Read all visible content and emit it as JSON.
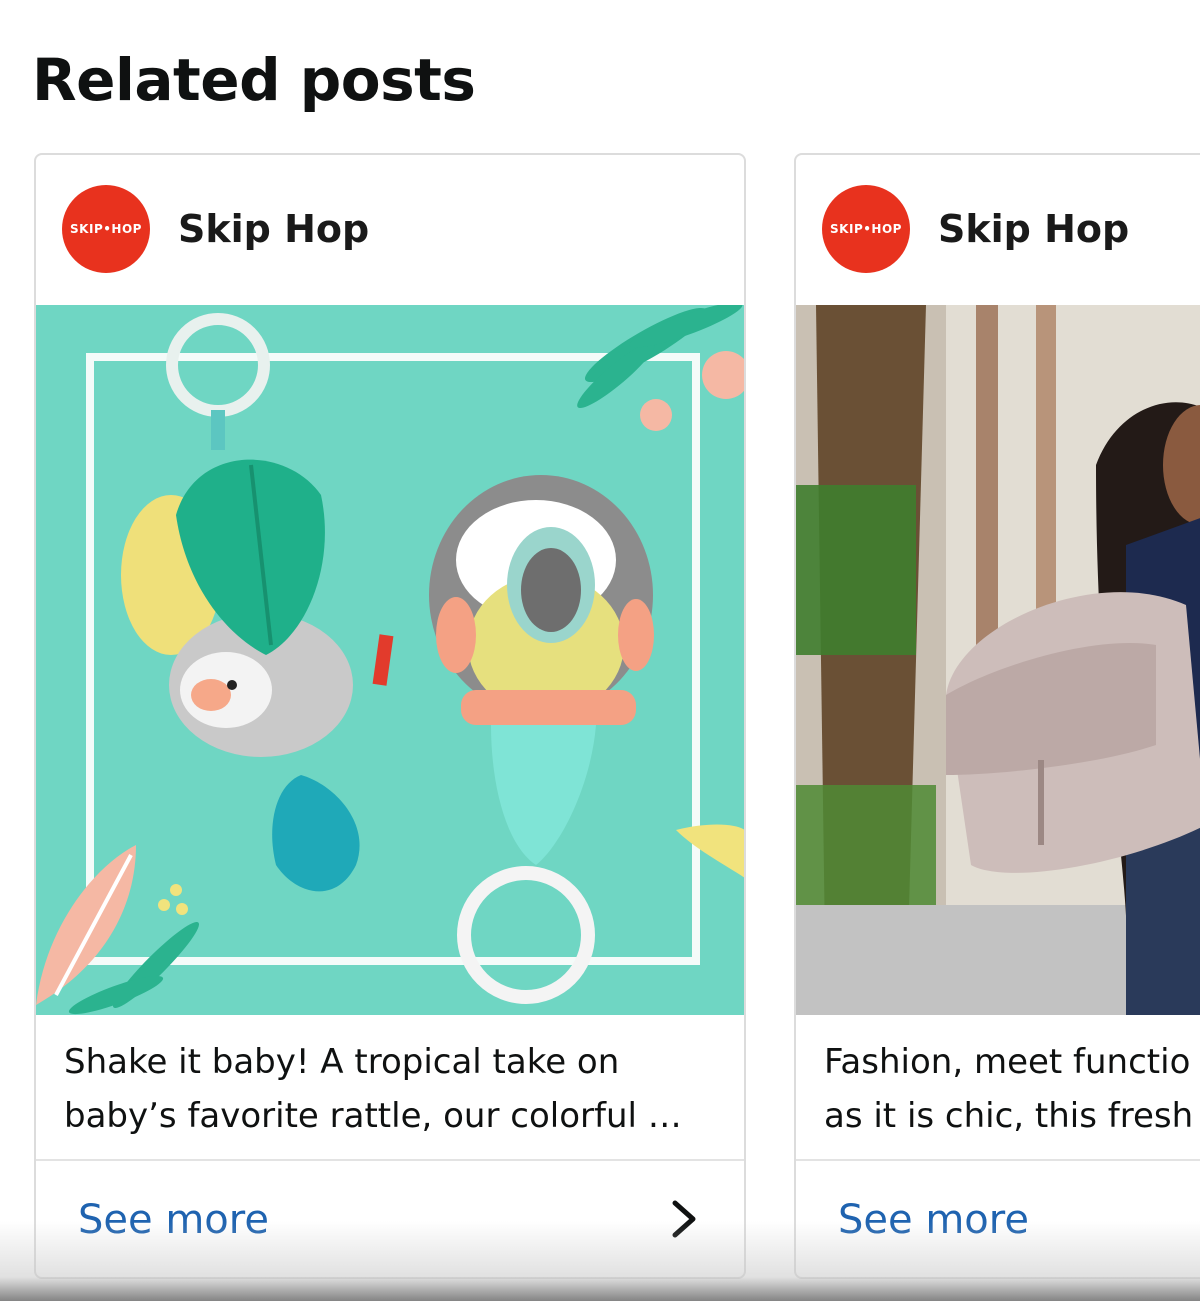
{
  "section": {
    "title": "Related posts"
  },
  "posts": [
    {
      "brand": "Skip Hop",
      "logo_text": "SKIP•HOP",
      "image_alt": "Skip Hop tropical sloth and toucan rattle toys on a mint background",
      "caption_lines": [
        "Shake it baby! A tropical take on",
        "baby’s favorite rattle, our colorful …"
      ],
      "see_more": "See more",
      "chevron_icon": "chevron-right-icon"
    },
    {
      "brand": "Skip Hop",
      "logo_text": "SKIP•HOP",
      "image_alt": "Woman carrying a taupe Skip Hop diaper backpack on a sidewalk",
      "caption_lines": [
        "Fashion, meet functio",
        "as it is chic, this fresh"
      ],
      "see_more": "See more"
    }
  ],
  "colors": {
    "logo_red": "#e8321e",
    "link_blue": "#1f63b0",
    "mint_bg": "#6fd6c3"
  }
}
